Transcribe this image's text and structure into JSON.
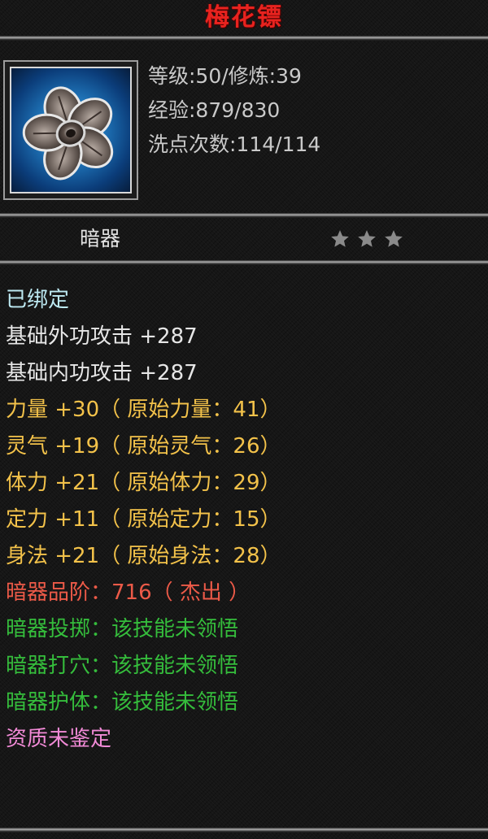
{
  "item": {
    "title": "梅花镖",
    "icon": "plum-blossom-dart-icon",
    "level_line": "等级:50/修炼:39",
    "exp_line": "经验:879/830",
    "reset_line": "洗点次数:114/114",
    "category": "暗器",
    "star_rating": 3,
    "star_color": "#8a8a8a"
  },
  "attributes": [
    {
      "text": "已绑定",
      "color": "#bde9f2"
    },
    {
      "text": "基础外功攻击 +287",
      "color": "#e6e6e6"
    },
    {
      "text": "基础内功攻击 +287",
      "color": "#e6e6e6"
    },
    {
      "text": "力量 +30（ 原始力量：41）",
      "color": "#f3c24a"
    },
    {
      "text": "灵气 +19（ 原始灵气：26）",
      "color": "#f3c24a"
    },
    {
      "text": "体力 +21（ 原始体力：29）",
      "color": "#f3c24a"
    },
    {
      "text": "定力 +11（ 原始定力：15）",
      "color": "#f3c24a"
    },
    {
      "text": "身法 +21（ 原始身法：28）",
      "color": "#f3c24a"
    },
    {
      "text": "暗器品阶：716（ 杰出 ）",
      "color": "#ec5a48"
    },
    {
      "text": "暗器投掷：该技能未领悟",
      "color": "#35bd3c"
    },
    {
      "text": "暗器打穴：该技能未领悟",
      "color": "#35bd3c"
    },
    {
      "text": "暗器护体：该技能未领悟",
      "color": "#35bd3c"
    },
    {
      "text": "资质未鉴定",
      "color": "#f18ad6"
    }
  ]
}
